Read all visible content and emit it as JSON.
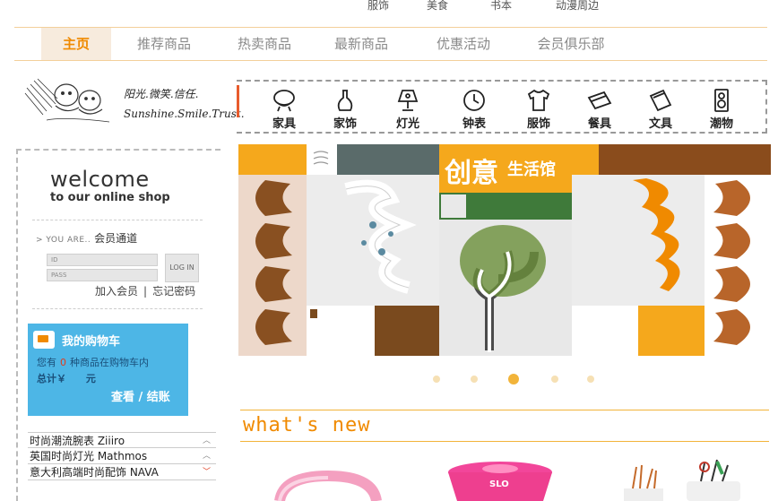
{
  "top_categories": [
    "服饰",
    "美食",
    "书本",
    "动漫周边"
  ],
  "nav": {
    "items": [
      "主页",
      "推荐商品",
      "热卖商品",
      "最新商品",
      "优惠活动",
      "会员俱乐部"
    ],
    "active_index": 0
  },
  "brand": {
    "slogan_cn": "阳光.微笑.信任.",
    "slogan_en": "Sunshine.Smile.Trust."
  },
  "welcome": {
    "title": "welcome",
    "subtitle": "to our online shop"
  },
  "login": {
    "section_en": "> YOU ARE..",
    "section_cn": "会员通道",
    "id_placeholder": "ID",
    "pass_placeholder": "PASS",
    "button": "LOG IN",
    "join": "加入会员",
    "separator": "|",
    "forgot": "忘记密码"
  },
  "cart": {
    "title": "我的购物车",
    "line1_prefix": "您有",
    "count": "0",
    "line1_suffix": "种商品在购物车内",
    "total_label": "总计￥",
    "total_unit": "元",
    "checkout": "查看 / 结账"
  },
  "brand_list": [
    {
      "label": "时尚潮流腕表 Ziiiro",
      "chevron": "︿"
    },
    {
      "label": "英国时尚灯光 Mathmos",
      "chevron": "︿"
    },
    {
      "label": "意大利高端时尚配饰 NAVA",
      "chevron": "﹀"
    }
  ],
  "categories": [
    {
      "label": "家具",
      "icon": "chair-icon"
    },
    {
      "label": "家饰",
      "icon": "vase-icon"
    },
    {
      "label": "灯光",
      "icon": "lamp-icon"
    },
    {
      "label": "钟表",
      "icon": "clock-icon"
    },
    {
      "label": "服饰",
      "icon": "tshirt-icon"
    },
    {
      "label": "餐具",
      "icon": "tableware-icon"
    },
    {
      "label": "文具",
      "icon": "notebook-icon"
    },
    {
      "label": "潮物",
      "icon": "speaker-icon"
    }
  ],
  "slider": {
    "banner_cn_1": "创意",
    "banner_cn_2": "生活馆",
    "active_dot": 2,
    "dot_count": 5
  },
  "whats_new": {
    "title": "what's new"
  },
  "colors": {
    "accent": "#f08a00",
    "cart_bg": "#4db6e6",
    "nav_active_bg": "#f7ebdd"
  }
}
